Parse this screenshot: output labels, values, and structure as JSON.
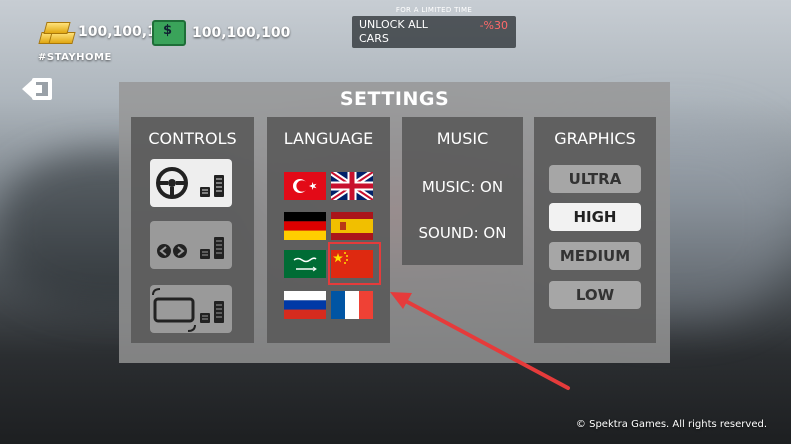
{
  "currency": {
    "gold_value": "100,100,100",
    "cash_value": "100,100,100"
  },
  "hashtag": "#STAYHOME",
  "promo": {
    "caption": "FOR A LIMITED TIME",
    "title": "UNLOCK ALL CARS",
    "discount": "-%30"
  },
  "settings": {
    "title": "SETTINGS",
    "controls": {
      "label": "CONTROLS",
      "options": [
        {
          "name": "steering-wheel",
          "selected": true
        },
        {
          "name": "arrow-buttons",
          "selected": false
        },
        {
          "name": "tilt-device",
          "selected": false
        }
      ]
    },
    "language": {
      "label": "LANGUAGE",
      "flags": [
        "Turkish",
        "English",
        "German",
        "Spanish",
        "Arabic",
        "Chinese",
        "Russian",
        "French"
      ],
      "highlighted": "Chinese"
    },
    "music": {
      "label": "MUSIC",
      "music_status": "MUSIC: ON",
      "sound_status": "SOUND: ON"
    },
    "graphics": {
      "label": "GRAPHICS",
      "options": [
        "ULTRA",
        "HIGH",
        "MEDIUM",
        "LOW"
      ],
      "selected": "HIGH"
    }
  },
  "copyright": "© Spektra Games. All rights reserved.",
  "colors": {
    "annotation": "#e53b3b",
    "panel": "#969696",
    "column": "#5a5a5a"
  }
}
